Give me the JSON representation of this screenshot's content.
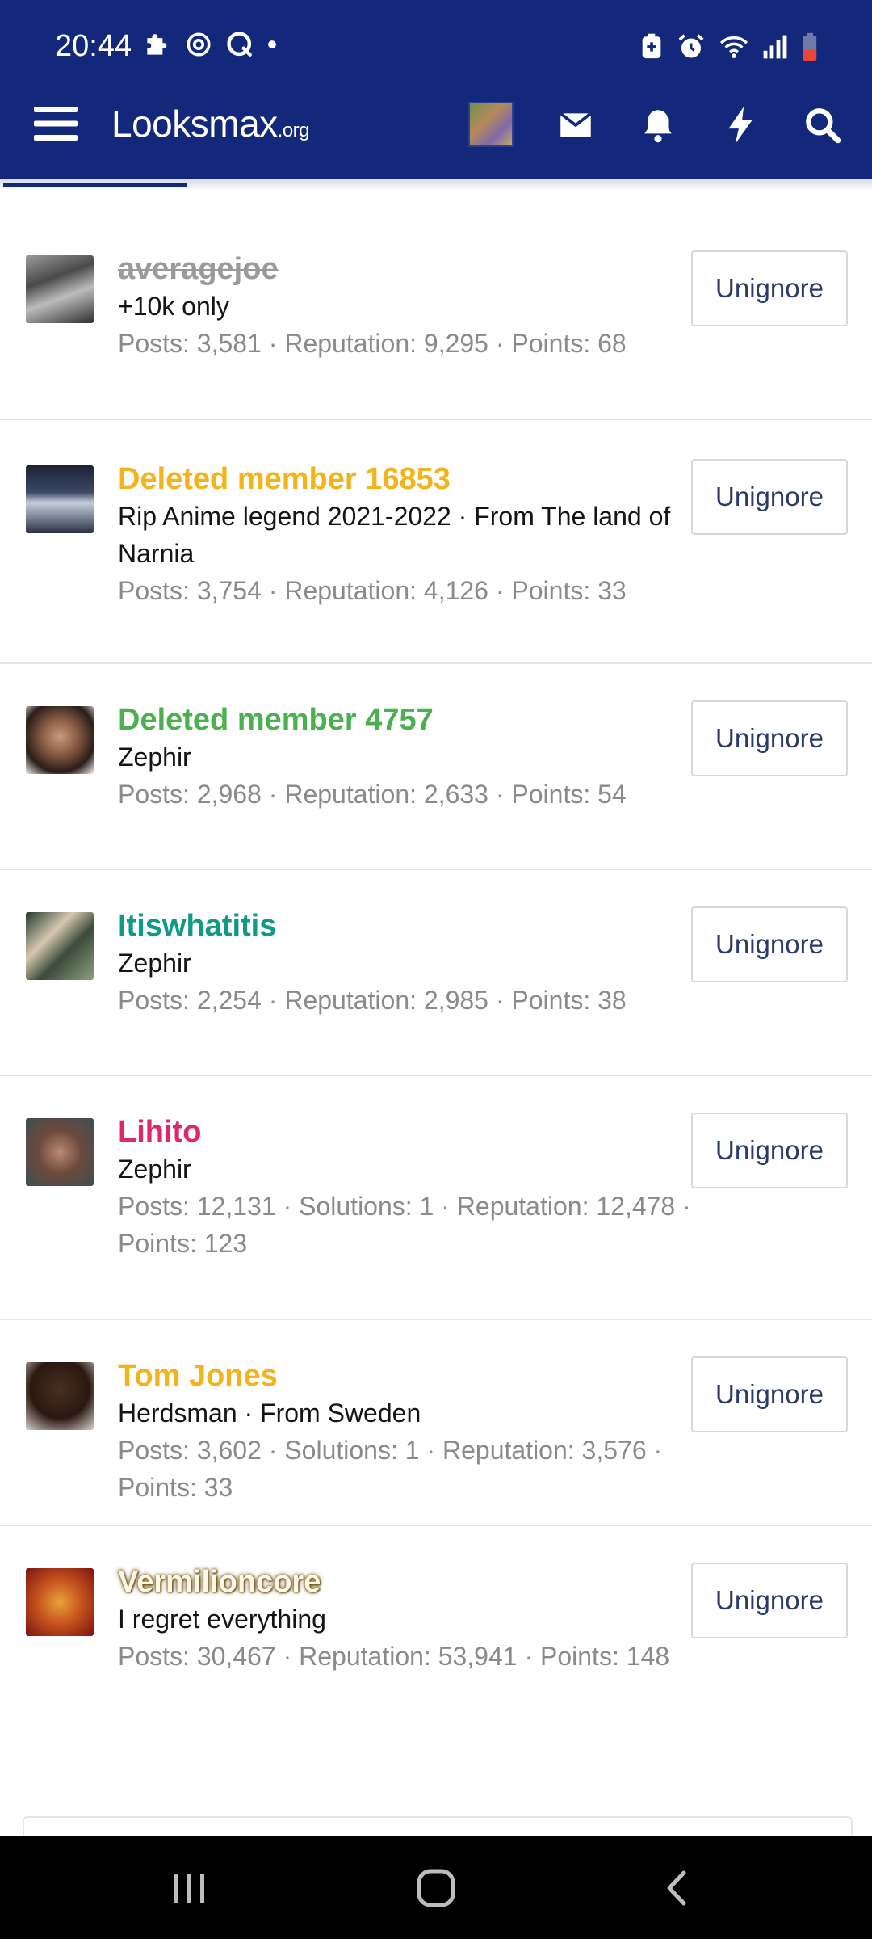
{
  "status_bar": {
    "time": "20:44"
  },
  "header": {
    "logo_main": "Looksmax",
    "logo_domain": ".org",
    "bg_color": "#13287a",
    "icons": [
      "menu-icon",
      "avatar",
      "envelope-icon",
      "bell-icon",
      "bolt-icon",
      "search-icon"
    ]
  },
  "members": [
    {
      "username": "averagejoe",
      "username_style": "strikethrough",
      "username_color": "#9a9a9a",
      "title": "+10k only",
      "stats": "Posts: 3,581 · Reputation: 9,295 · Points: 68",
      "button_label": "Unignore"
    },
    {
      "username": "Deleted member 16853",
      "username_color": "#f2b31b",
      "title": "Rip Anime legend 2021-2022 · From The land of Narnia",
      "stats": "Posts: 3,754 · Reputation: 4,126 · Points: 33",
      "button_label": "Unignore"
    },
    {
      "username": "Deleted member 4757",
      "username_color": "#4caf50",
      "title": "Zephir",
      "stats": "Posts: 2,968 · Reputation: 2,633 · Points: 54",
      "button_label": "Unignore"
    },
    {
      "username": "Itiswhatitis",
      "username_color": "#0f9a86",
      "title": "Zephir",
      "stats": "Posts: 2,254 · Reputation: 2,985 · Points: 38",
      "button_label": "Unignore"
    },
    {
      "username": "Lihito",
      "username_color": "#e0276b",
      "title": "Zephir",
      "stats": "Posts: 12,131 · Solutions: 1 · Reputation: 12,478 · Points: 123",
      "button_label": "Unignore"
    },
    {
      "username": "Tom Jones",
      "username_color": "#f2b31b",
      "title": "Herdsman · From Sweden",
      "stats": "Posts: 3,602 · Solutions: 1 · Reputation: 3,576 · Points: 33",
      "button_label": "Unignore"
    },
    {
      "username": "Vermilioncore",
      "username_style": "glow",
      "username_color": "#fff8e6",
      "title": "I regret everything",
      "stats": "Posts: 30,467 · Reputation: 53,941 · Points: 148",
      "button_label": "Unignore"
    }
  ],
  "system_nav": {
    "buttons": [
      "recents-icon",
      "home-icon",
      "back-icon"
    ]
  }
}
